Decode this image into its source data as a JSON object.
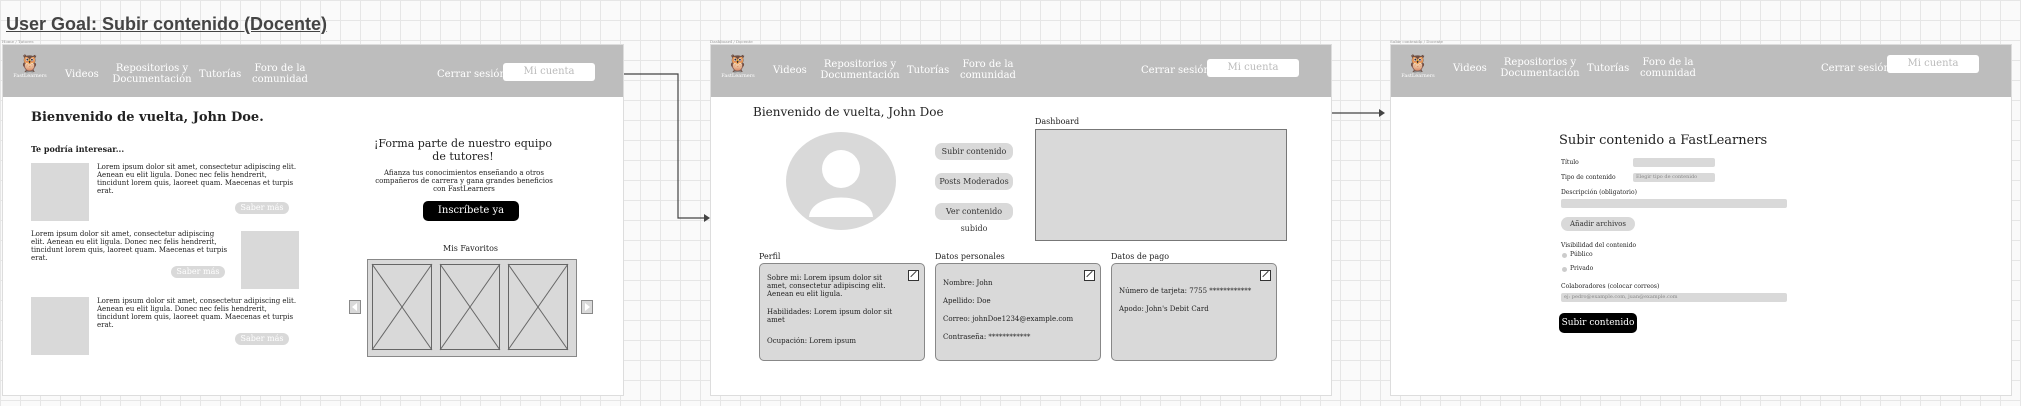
{
  "user_goal": "User Goal: Subir contenido (Docente)",
  "frames": [
    {
      "tag": "Home / Tutores"
    },
    {
      "tag": "Dashboard / Docente"
    },
    {
      "tag": "Subir contenido / Docente"
    }
  ],
  "nav": {
    "logo_text": "FastLearners",
    "videos": "Videos",
    "repos": "Repositorios y Documentación",
    "tutorias": "Tutorías",
    "foro": "Foro de la comunidad",
    "logout": "Cerrar sesión",
    "account": "Mi cuenta"
  },
  "home": {
    "welcome": "Bienvenido de vuelta, John Doe.",
    "interest": "Te podría interesar...",
    "lorem": "Lorem ipsum dolor sit amet, consectetur adipiscing elit. Aenean eu elit ligula. Donec nec felis hendrerit, tincidunt lorem quis, laoreet quam. Maecenas et turpis erat.",
    "more": "Saber más",
    "join_title": "¡Forma parte de nuestro equipo de tutores!",
    "join_text": "Afianza tus conocimientos enseñando a otros compañeros de carrera y gana grandes beneficios con FastLearners",
    "join_button": "Inscríbete ya",
    "favorites": "Mis Favoritos"
  },
  "dashboard": {
    "welcome": "Bienvenido de vuelta, John Doe",
    "buttons": [
      "Subir contenido",
      "Posts Moderados",
      "Ver contenido subido"
    ],
    "dashboard_label": "Dashboard",
    "profile": {
      "title": "Perfil",
      "about": "Sobre mi: Lorem ipsum dolor sit amet, consectetur adipiscing elit. Aenean eu elit ligula.",
      "skills": "Habilidades: Lorem ipsum dolor sit amet",
      "job": "Ocupación: Lorem ipsum"
    },
    "personal": {
      "title": "Datos personales",
      "name": "Nombre: John",
      "surname": "Apellido: Doe",
      "email": "Correo: johnDoe1234@example.com",
      "password": "Contraseña: ************"
    },
    "payment": {
      "title": "Datos de pago",
      "card": "Número de tarjeta: 7755 ************",
      "alias": "Apodo: John's Debit Card"
    }
  },
  "upload": {
    "title": "Subir contenido a FastLearners",
    "field_title": "Título",
    "field_type": "Tipo de contenido",
    "type_placeholder": "Elegir tipo de contenido",
    "field_desc": "Descripción (obligatorio)",
    "add_files": "Añadir archivos",
    "visibility": "Visibilidad del contenido",
    "public": "Público",
    "private": "Privado",
    "collaborators": "Colaboradores (colocar correos)",
    "collab_placeholder": "ej: pedro@example.com, juan@example.com",
    "submit": "Subir contenido"
  }
}
